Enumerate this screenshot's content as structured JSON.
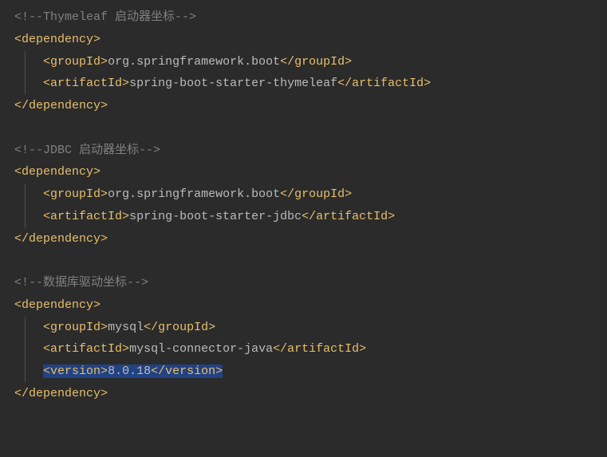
{
  "lines": [
    {
      "type": "comment",
      "indent": 0,
      "parts": [
        {
          "style": "comment",
          "text": "<!--Thymeleaf 启动器坐标-->"
        }
      ]
    },
    {
      "type": "code",
      "indent": 0,
      "parts": [
        {
          "style": "bracket",
          "text": "<"
        },
        {
          "style": "tag",
          "text": "dependency"
        },
        {
          "style": "bracket",
          "text": ">"
        }
      ]
    },
    {
      "type": "code",
      "indent": 1,
      "guide": true,
      "parts": [
        {
          "style": "bracket",
          "text": "<"
        },
        {
          "style": "tag",
          "text": "groupId"
        },
        {
          "style": "bracket",
          "text": ">"
        },
        {
          "style": "text",
          "text": "org.springframework.boot"
        },
        {
          "style": "bracket",
          "text": "</"
        },
        {
          "style": "tag",
          "text": "groupId"
        },
        {
          "style": "bracket",
          "text": ">"
        }
      ]
    },
    {
      "type": "code",
      "indent": 1,
      "guide": true,
      "parts": [
        {
          "style": "bracket",
          "text": "<"
        },
        {
          "style": "tag",
          "text": "artifactId"
        },
        {
          "style": "bracket",
          "text": ">"
        },
        {
          "style": "text",
          "text": "spring-boot-starter-thymeleaf"
        },
        {
          "style": "bracket",
          "text": "</"
        },
        {
          "style": "tag",
          "text": "artifactId"
        },
        {
          "style": "bracket",
          "text": ">"
        }
      ]
    },
    {
      "type": "code",
      "indent": 0,
      "parts": [
        {
          "style": "bracket",
          "text": "</"
        },
        {
          "style": "tag",
          "text": "dependency"
        },
        {
          "style": "bracket",
          "text": ">"
        }
      ]
    },
    {
      "type": "blank"
    },
    {
      "type": "comment",
      "indent": 0,
      "parts": [
        {
          "style": "comment",
          "text": "<!--JDBC 启动器坐标-->"
        }
      ]
    },
    {
      "type": "code",
      "indent": 0,
      "parts": [
        {
          "style": "bracket",
          "text": "<"
        },
        {
          "style": "tag",
          "text": "dependency"
        },
        {
          "style": "bracket",
          "text": ">"
        }
      ]
    },
    {
      "type": "code",
      "indent": 1,
      "guide": true,
      "parts": [
        {
          "style": "bracket",
          "text": "<"
        },
        {
          "style": "tag",
          "text": "groupId"
        },
        {
          "style": "bracket",
          "text": ">"
        },
        {
          "style": "text",
          "text": "org.springframework.boot"
        },
        {
          "style": "bracket",
          "text": "</"
        },
        {
          "style": "tag",
          "text": "groupId"
        },
        {
          "style": "bracket",
          "text": ">"
        }
      ]
    },
    {
      "type": "code",
      "indent": 1,
      "guide": true,
      "parts": [
        {
          "style": "bracket",
          "text": "<"
        },
        {
          "style": "tag",
          "text": "artifactId"
        },
        {
          "style": "bracket",
          "text": ">"
        },
        {
          "style": "text",
          "text": "spring-boot-starter-jdbc"
        },
        {
          "style": "bracket",
          "text": "</"
        },
        {
          "style": "tag",
          "text": "artifactId"
        },
        {
          "style": "bracket",
          "text": ">"
        }
      ]
    },
    {
      "type": "code",
      "indent": 0,
      "parts": [
        {
          "style": "bracket",
          "text": "</"
        },
        {
          "style": "tag",
          "text": "dependency"
        },
        {
          "style": "bracket",
          "text": ">"
        }
      ]
    },
    {
      "type": "blank"
    },
    {
      "type": "comment",
      "indent": 0,
      "parts": [
        {
          "style": "comment",
          "text": "<!--数据库驱动坐标-->"
        }
      ]
    },
    {
      "type": "code",
      "indent": 0,
      "parts": [
        {
          "style": "bracket",
          "text": "<"
        },
        {
          "style": "tag",
          "text": "dependency"
        },
        {
          "style": "bracket",
          "text": ">"
        }
      ]
    },
    {
      "type": "code",
      "indent": 1,
      "guide": true,
      "parts": [
        {
          "style": "bracket",
          "text": "<"
        },
        {
          "style": "tag",
          "text": "groupId"
        },
        {
          "style": "bracket",
          "text": ">"
        },
        {
          "style": "text",
          "text": "mysql"
        },
        {
          "style": "bracket",
          "text": "</"
        },
        {
          "style": "tag",
          "text": "groupId"
        },
        {
          "style": "bracket",
          "text": ">"
        }
      ]
    },
    {
      "type": "code",
      "indent": 1,
      "guide": true,
      "parts": [
        {
          "style": "bracket",
          "text": "<"
        },
        {
          "style": "tag",
          "text": "artifactId"
        },
        {
          "style": "bracket",
          "text": ">"
        },
        {
          "style": "text",
          "text": "mysql-connector-java"
        },
        {
          "style": "bracket",
          "text": "</"
        },
        {
          "style": "tag",
          "text": "artifactId"
        },
        {
          "style": "bracket",
          "text": ">"
        }
      ]
    },
    {
      "type": "code",
      "indent": 1,
      "guide": true,
      "highlighted": true,
      "parts": [
        {
          "style": "bracket",
          "text": "<"
        },
        {
          "style": "tag",
          "text": "version"
        },
        {
          "style": "bracket",
          "text": ">"
        },
        {
          "style": "text",
          "text": "8.0.18"
        },
        {
          "style": "bracket",
          "text": "</"
        },
        {
          "style": "tag",
          "text": "version"
        },
        {
          "style": "bracket",
          "text": ">"
        }
      ]
    },
    {
      "type": "code",
      "indent": 0,
      "parts": [
        {
          "style": "bracket",
          "text": "</"
        },
        {
          "style": "tag",
          "text": "dependency"
        },
        {
          "style": "bracket",
          "text": ">"
        }
      ]
    }
  ]
}
